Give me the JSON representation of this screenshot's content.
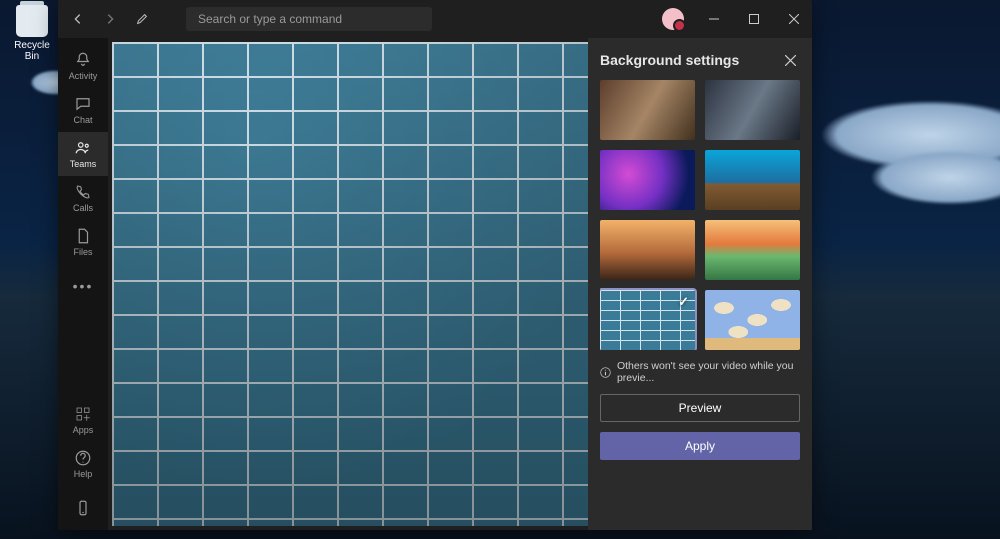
{
  "desktop": {
    "recycle_bin": "Recycle Bin"
  },
  "titlebar": {
    "search_placeholder": "Search or type a command"
  },
  "rail": {
    "items": [
      {
        "id": "activity",
        "label": "Activity"
      },
      {
        "id": "chat",
        "label": "Chat"
      },
      {
        "id": "teams",
        "label": "Teams",
        "active": true
      },
      {
        "id": "calls",
        "label": "Calls"
      },
      {
        "id": "files",
        "label": "Files"
      }
    ],
    "more_label": "",
    "apps_label": "Apps",
    "help_label": "Help"
  },
  "panel": {
    "title": "Background settings",
    "thumbs": [
      {
        "id": "street-dusk",
        "selected": false
      },
      {
        "id": "mountain-grey",
        "selected": false
      },
      {
        "id": "nebula",
        "selected": false
      },
      {
        "id": "moon-cliff",
        "selected": false
      },
      {
        "id": "old-town",
        "selected": false
      },
      {
        "id": "sunset-hiker",
        "selected": false
      },
      {
        "id": "blue-brick",
        "selected": true
      },
      {
        "id": "clouds-wall",
        "selected": false
      }
    ],
    "notice": "Others won't see your video while you previe...",
    "preview_label": "Preview",
    "apply_label": "Apply"
  }
}
